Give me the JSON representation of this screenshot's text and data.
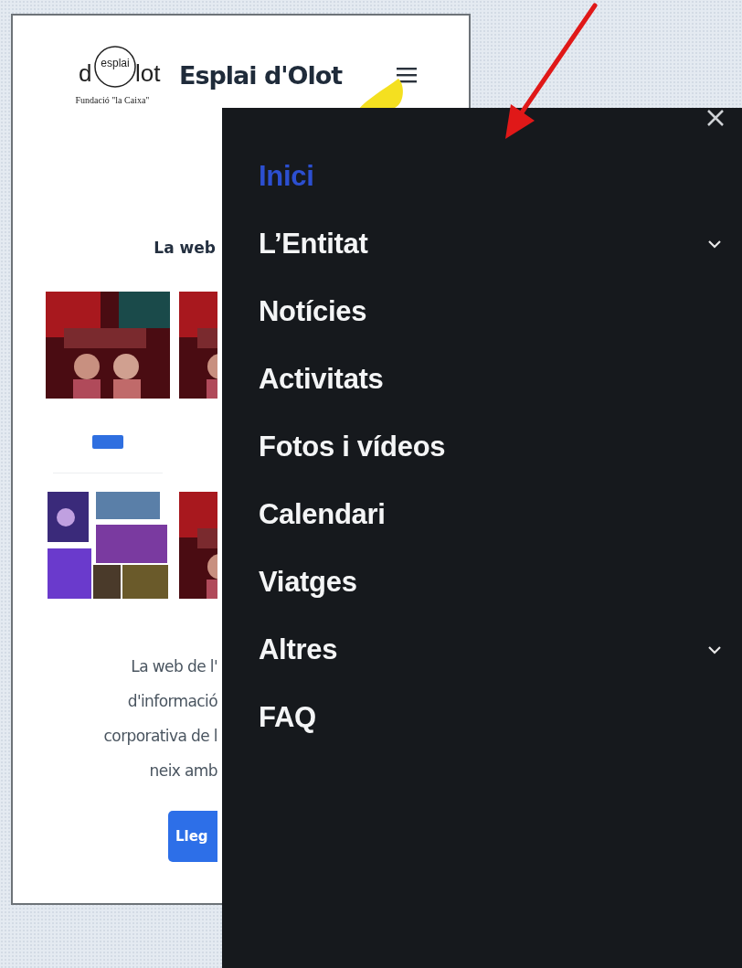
{
  "site_header": {
    "logo": {
      "letter_left": "d",
      "circle_word": "esplai",
      "letters_right": "lot",
      "caption": "Fundació \"la Caixa\""
    },
    "title": "Esplai d'Olot"
  },
  "content": {
    "heading": "La web",
    "tiles": [
      {
        "kind": "picture",
        "has_button": true
      },
      {
        "kind": "picture",
        "has_button": false
      },
      {
        "kind": "collage",
        "has_button": false
      },
      {
        "kind": "picture",
        "has_button": false
      }
    ],
    "paragraph_lines": [
      "La web de l'",
      "d'informació",
      "corporativa de l",
      "neix amb"
    ],
    "button": "Lleg"
  },
  "menu": {
    "items": [
      {
        "label": "Inici",
        "selected": true,
        "expandable": false
      },
      {
        "label": "L’Entitat",
        "selected": false,
        "expandable": true
      },
      {
        "label": "Notícies",
        "selected": false,
        "expandable": false
      },
      {
        "label": "Activitats",
        "selected": false,
        "expandable": false
      },
      {
        "label": "Fotos i vídeos",
        "selected": false,
        "expandable": false
      },
      {
        "label": "Calendari",
        "selected": false,
        "expandable": false
      },
      {
        "label": "Viatges",
        "selected": false,
        "expandable": false
      },
      {
        "label": "Altres",
        "selected": false,
        "expandable": true
      },
      {
        "label": "FAQ",
        "selected": false,
        "expandable": false
      }
    ]
  }
}
